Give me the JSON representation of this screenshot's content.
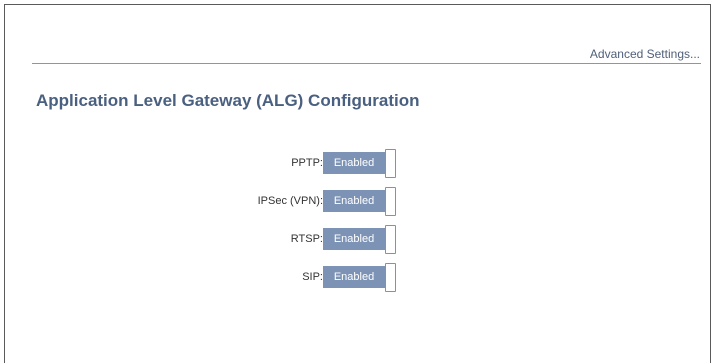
{
  "header": {
    "advanced_link": "Advanced Settings..."
  },
  "page": {
    "title": "Application Level Gateway (ALG) Configuration"
  },
  "alg_settings": [
    {
      "label": "PPTP:",
      "state": "Enabled"
    },
    {
      "label": "IPSec (VPN):",
      "state": "Enabled"
    },
    {
      "label": "RTSP:",
      "state": "Enabled"
    },
    {
      "label": "SIP:",
      "state": "Enabled"
    }
  ],
  "colors": {
    "toggle_fill": "#7d93b6",
    "title": "#4a6080",
    "link": "#50607a"
  }
}
